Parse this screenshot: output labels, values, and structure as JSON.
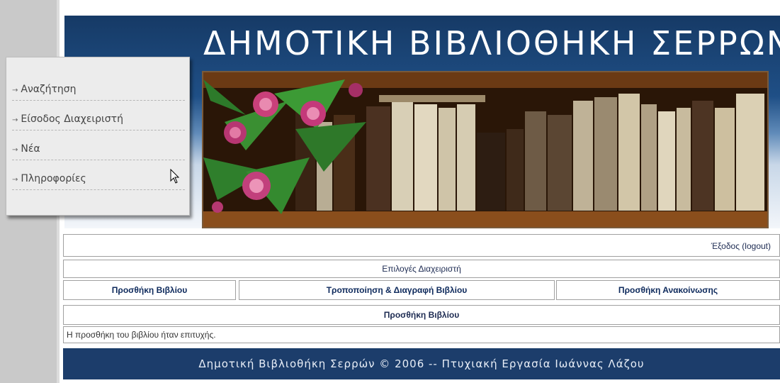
{
  "site": {
    "title": "ΔΗΜΟΤΙΚΗ ΒΙΒΛΙΟΘΗΚΗ ΣΕΡΡΩΝ"
  },
  "menu": {
    "items": [
      {
        "label": "Αναζήτηση"
      },
      {
        "label": "Είσοδος Διαχειριστή"
      },
      {
        "label": "Νέα"
      },
      {
        "label": "Πληροφορίες"
      }
    ]
  },
  "admin": {
    "logout_label": "Έξοδος (logout)",
    "options_title": "Επιλογές Διαχειριστή",
    "actions": [
      {
        "label": "Προσθήκη Βιβλίου"
      },
      {
        "label": "Τροποποίηση & Διαγραφή Βιβλίου"
      },
      {
        "label": "Προσθήκη Ανακοίνωσης"
      }
    ],
    "section_title": "Προσθήκη Βιβλίου",
    "message": "Η προσθήκη του βιβλίου ήταν επιτυχής."
  },
  "footer": {
    "text": "Δημοτική Βιβλιοθήκη Σερρών © 2006  -- Πτυχιακή Εργασία Ιωάννας Λάζου"
  }
}
